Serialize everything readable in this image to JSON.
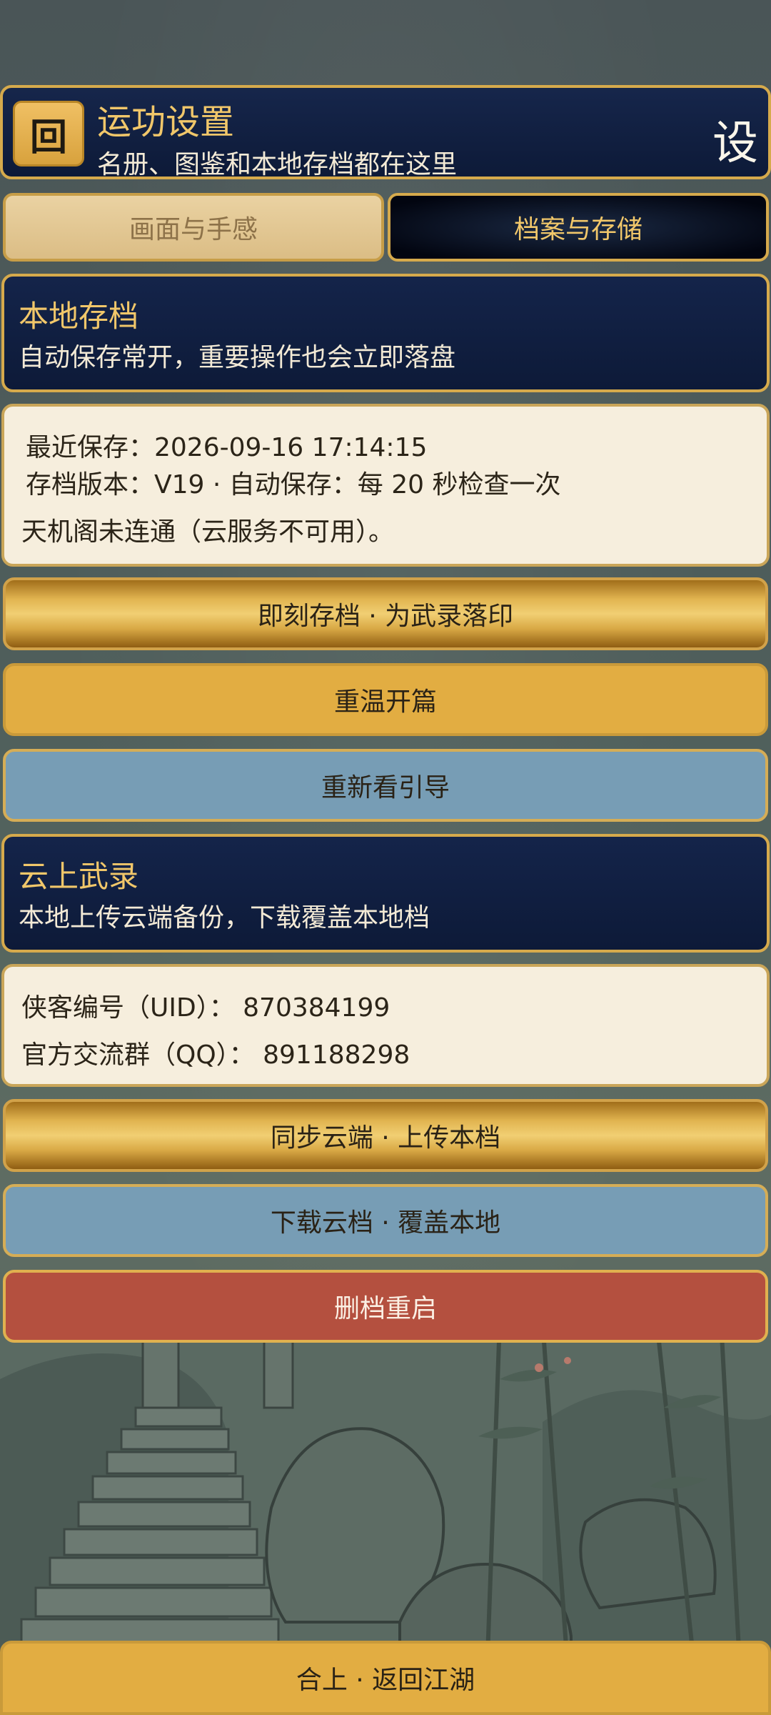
{
  "header": {
    "back_icon_glyph": "回",
    "title": "运功设置",
    "subtitle": "名册、图鉴和本地存档都在这里",
    "corner_char": "设"
  },
  "tabs": [
    {
      "label": "画面与手感",
      "active": false
    },
    {
      "label": "档案与存储",
      "active": true
    }
  ],
  "local_save": {
    "title": "本地存档",
    "subtitle": "自动保存常开，重要操作也会立即落盘",
    "last_saved": "最近保存：2026-09-16 17:14:15",
    "version_line": "存档版本：V19 · 自动保存：每 20 秒检查一次",
    "cloud_status": "天机阁未连通（云服务不可用）。"
  },
  "actions": {
    "save_now": "即刻存档 · 为武录落印",
    "replay_opening": "重温开篇",
    "rewatch_guide": "重新看引导"
  },
  "cloud": {
    "title": "云上武录",
    "subtitle": "本地上传云端备份，下载覆盖本地档",
    "uid_line": "侠客编号（UID）：  870384199",
    "qq_line": "官方交流群（QQ）：  891188298",
    "sync_upload": "同步云端 · 上传本档",
    "download_overwrite": "下载云档 · 覆盖本地",
    "delete_restart": "删档重启"
  },
  "footer": {
    "close_label": "合上 · 返回江湖"
  },
  "colors": {
    "navy": "#0d1a38",
    "gold_border": "#d6aa4c",
    "gold_text": "#f1c76a",
    "cream": "#f6eedd",
    "blue_button": "#779db5",
    "red_button": "#b4503f"
  }
}
